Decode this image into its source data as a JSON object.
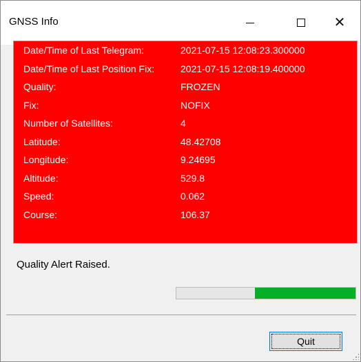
{
  "window": {
    "title": "GNSS Info"
  },
  "titlebar_buttons": {
    "minimize_icon": "minimize-icon",
    "maximize_icon": "maximize-icon",
    "close_icon": "close-icon",
    "close_glyph": "✕"
  },
  "info": {
    "background_color": "#ff0000",
    "rows": [
      {
        "label": "Date/Time of Last Telegram:",
        "value": "2021-07-15 12:08:23.300000"
      },
      {
        "label": "Date/Time of Last Position Fix:",
        "value": "2021-07-15 12:08:19.400000"
      },
      {
        "label": "Quality:",
        "value": "FROZEN"
      },
      {
        "label": "Fix:",
        "value": "NOFIX"
      },
      {
        "label": "Number of Satellites:",
        "value": "4"
      },
      {
        "label": "Latitude:",
        "value": "48.42708"
      },
      {
        "label": "Longitude:",
        "value": "9.24695"
      },
      {
        "label": "Altitude:",
        "value": "529.8"
      },
      {
        "label": "Speed:",
        "value": "0.062"
      },
      {
        "label": "Course:",
        "value": "106.37"
      }
    ]
  },
  "status": {
    "message": "Quality Alert Raised."
  },
  "progress": {
    "fill_start": 0.44,
    "fill_end": 1.0,
    "color": "#06b025"
  },
  "buttons": {
    "quit_label": "Quit"
  }
}
